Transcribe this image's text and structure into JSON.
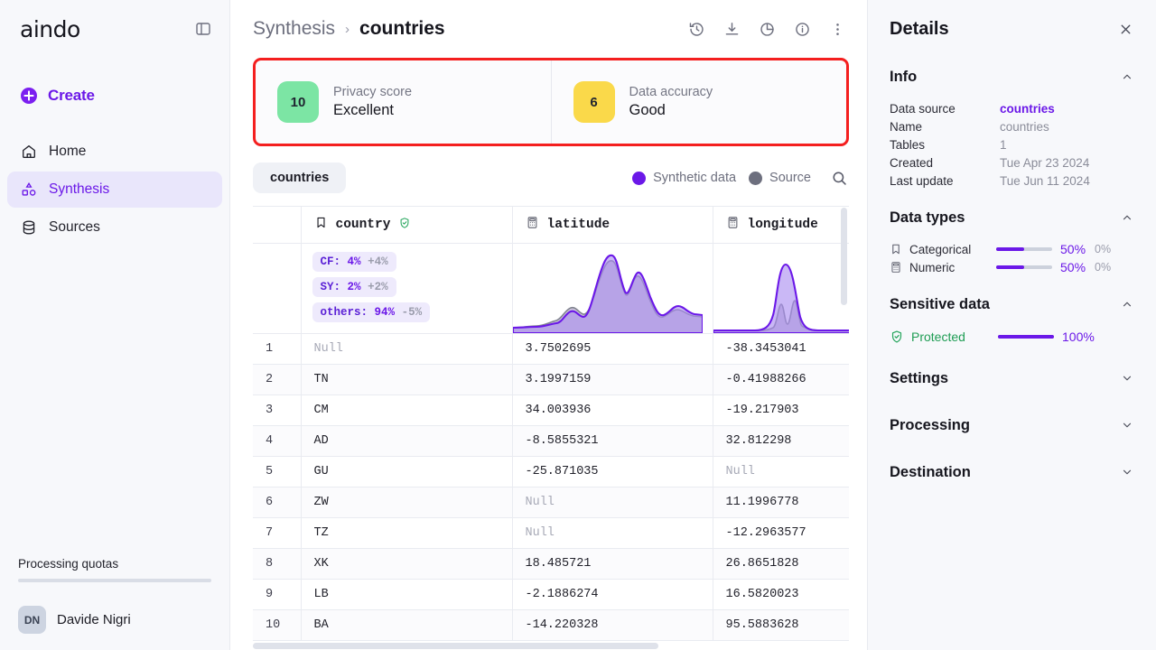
{
  "sidebar": {
    "logo": "aindo",
    "panel_toggle_icon": "panel-collapse-icon",
    "create_label": "Create",
    "items": [
      {
        "label": "Home",
        "icon": "home-icon",
        "active": false
      },
      {
        "label": "Synthesis",
        "icon": "shapes-icon",
        "active": true
      },
      {
        "label": "Sources",
        "icon": "database-icon",
        "active": false
      }
    ],
    "quota_label": "Processing quotas",
    "user": {
      "initials": "DN",
      "name": "Davide Nigri"
    }
  },
  "header": {
    "breadcrumb_root": "Synthesis",
    "breadcrumb_sep": "›",
    "breadcrumb_current": "countries",
    "actions": [
      {
        "name": "history-icon"
      },
      {
        "name": "download-icon"
      },
      {
        "name": "pie-chart-icon"
      },
      {
        "name": "info-icon"
      },
      {
        "name": "more-vertical-icon"
      }
    ]
  },
  "scores": {
    "highlight_color": "#f41f1f",
    "cards": [
      {
        "value": "10",
        "label": "Privacy score",
        "rating": "Excellent",
        "color": "#7ce5a4"
      },
      {
        "value": "6",
        "label": "Data accuracy",
        "rating": "Good",
        "color": "#fad košice"
      }
    ]
  },
  "score_cards": [
    {
      "value": "10",
      "label": "Privacy score",
      "rating": "Excellent",
      "color": "#7ce5a4"
    },
    {
      "value": "6",
      "label": "Data accuracy",
      "rating": "Good",
      "color": "#fad94a"
    }
  ],
  "toolbar": {
    "tab_label": "countries",
    "legend": [
      {
        "label": "Synthetic data",
        "color": "#6b18e8"
      },
      {
        "label": "Source",
        "color": "#6d6f7e"
      }
    ],
    "search_icon": "search-icon"
  },
  "table": {
    "columns": [
      {
        "name": "country",
        "icon": "bookmark-icon",
        "protected": true,
        "type": "categorical"
      },
      {
        "name": "latitude",
        "icon": "calculator-icon",
        "protected": false,
        "type": "numeric"
      },
      {
        "name": "longitude",
        "icon": "calculator-icon",
        "protected": false,
        "type": "numeric"
      }
    ],
    "country_stats": [
      {
        "key": "CF:",
        "value": "4%",
        "delta": "+4%"
      },
      {
        "key": "SY:",
        "value": "2%",
        "delta": "+2%"
      },
      {
        "key": "others:",
        "value": "94%",
        "delta": "-5%"
      }
    ],
    "rows": [
      {
        "idx": "1",
        "country": "Null",
        "latitude": "3.7502695",
        "longitude": "-38.3453041"
      },
      {
        "idx": "2",
        "country": "TN",
        "latitude": "3.1997159",
        "longitude": "-0.41988266"
      },
      {
        "idx": "3",
        "country": "CM",
        "latitude": "34.003936",
        "longitude": "-19.217903"
      },
      {
        "idx": "4",
        "country": "AD",
        "latitude": "-8.5855321",
        "longitude": "32.812298"
      },
      {
        "idx": "5",
        "country": "GU",
        "latitude": "-25.871035",
        "longitude": "Null"
      },
      {
        "idx": "6",
        "country": "ZW",
        "latitude": "Null",
        "longitude": "11.1996778"
      },
      {
        "idx": "7",
        "country": "TZ",
        "latitude": "Null",
        "longitude": "-12.2963577"
      },
      {
        "idx": "8",
        "country": "XK",
        "latitude": "18.485721",
        "longitude": "26.8651828"
      },
      {
        "idx": "9",
        "country": "LB",
        "latitude": "-2.1886274",
        "longitude": "16.5820023"
      },
      {
        "idx": "10",
        "country": "BA",
        "latitude": "-14.220328",
        "longitude": "95.5883628"
      }
    ]
  },
  "details": {
    "title": "Details",
    "close_icon": "close-icon",
    "info": {
      "title": "Info",
      "expanded": true,
      "rows": [
        {
          "key": "Data source",
          "value": "countries",
          "link": true
        },
        {
          "key": "Name",
          "value": "countries",
          "link": false
        },
        {
          "key": "Tables",
          "value": "1",
          "link": false
        },
        {
          "key": "Created",
          "value": "Tue Apr 23 2024",
          "link": false
        },
        {
          "key": "Last update",
          "value": "Tue Jun 11 2024",
          "link": false
        }
      ]
    },
    "data_types": {
      "title": "Data types",
      "expanded": true,
      "rows": [
        {
          "icon": "bookmark-icon",
          "label": "Categorical",
          "percent": "50%",
          "fill": 50,
          "secondary": "0%"
        },
        {
          "icon": "calculator-icon",
          "label": "Numeric",
          "percent": "50%",
          "fill": 50,
          "secondary": "0%"
        }
      ]
    },
    "sensitive": {
      "title": "Sensitive data",
      "expanded": true,
      "label": "Protected",
      "icon": "shield-check-icon",
      "percent": "100%",
      "fill": 100
    },
    "collapsed_sections": [
      {
        "title": "Settings"
      },
      {
        "title": "Processing"
      },
      {
        "title": "Destination"
      }
    ]
  }
}
